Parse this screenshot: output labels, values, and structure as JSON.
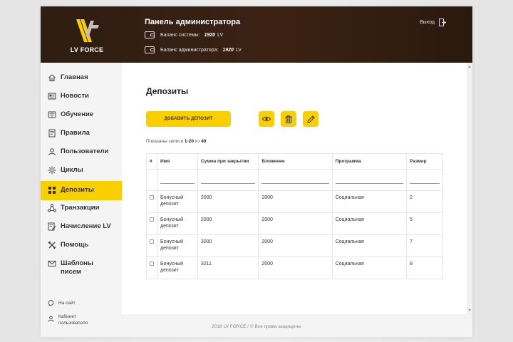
{
  "header": {
    "logo_text": "LV FORCE",
    "title": "Панель администратора",
    "system_balance_label": "Баланс системы:",
    "system_balance_value": "1920",
    "admin_balance_label": "Баланс администратора:",
    "admin_balance_value": "1920",
    "currency": "LV",
    "logout_label": "Выход"
  },
  "sidebar": {
    "items": [
      {
        "label": "Главная",
        "icon": "home-icon"
      },
      {
        "label": "Новости",
        "icon": "news-icon"
      },
      {
        "label": "Обучение",
        "icon": "education-icon"
      },
      {
        "label": "Правила",
        "icon": "rules-icon"
      },
      {
        "label": "Пользователи",
        "icon": "users-icon"
      },
      {
        "label": "Циклы",
        "icon": "cycles-icon"
      },
      {
        "label": "Депозиты",
        "icon": "deposits-icon"
      },
      {
        "label": "Транзакции",
        "icon": "transactions-icon"
      },
      {
        "label": "Начисление LV",
        "icon": "accrual-icon"
      },
      {
        "label": "Помощь",
        "icon": "help-icon"
      },
      {
        "label": "Шаблоны писем",
        "icon": "mail-icon"
      }
    ],
    "active_index": 6,
    "to_site": "На сайт",
    "user_cabinet": "Кабинет пользователя"
  },
  "main": {
    "title": "Депозиты",
    "add_button": "ДОБАВИТЬ ДЕПОЗИТ",
    "records_prefix": "Показаны записи",
    "records_range": "1-20",
    "records_of": "из",
    "records_total": "40",
    "table": {
      "columns": [
        "#",
        "Имя",
        "Сумма при закрытии",
        "Вложение",
        "Программа",
        "Размер"
      ],
      "rows": [
        {
          "name": "Бонусный депозит",
          "close_sum": "2000",
          "investment": "2000",
          "program": "Социальная",
          "size": "2"
        },
        {
          "name": "Бонусный депозит",
          "close_sum": "2000",
          "investment": "2000",
          "program": "Социальная",
          "size": "5"
        },
        {
          "name": "Бонусный депозит",
          "close_sum": "3000",
          "investment": "2000",
          "program": "Социальная",
          "size": "7"
        },
        {
          "name": "Бонусный депозит",
          "close_sum": "3211",
          "investment": "2000",
          "program": "Социальная",
          "size": "8"
        }
      ]
    }
  },
  "footer": "2018 LV FORCE / © Все права защищены",
  "colors": {
    "accent": "#f9cf00",
    "header_bg": "#3b2213"
  }
}
